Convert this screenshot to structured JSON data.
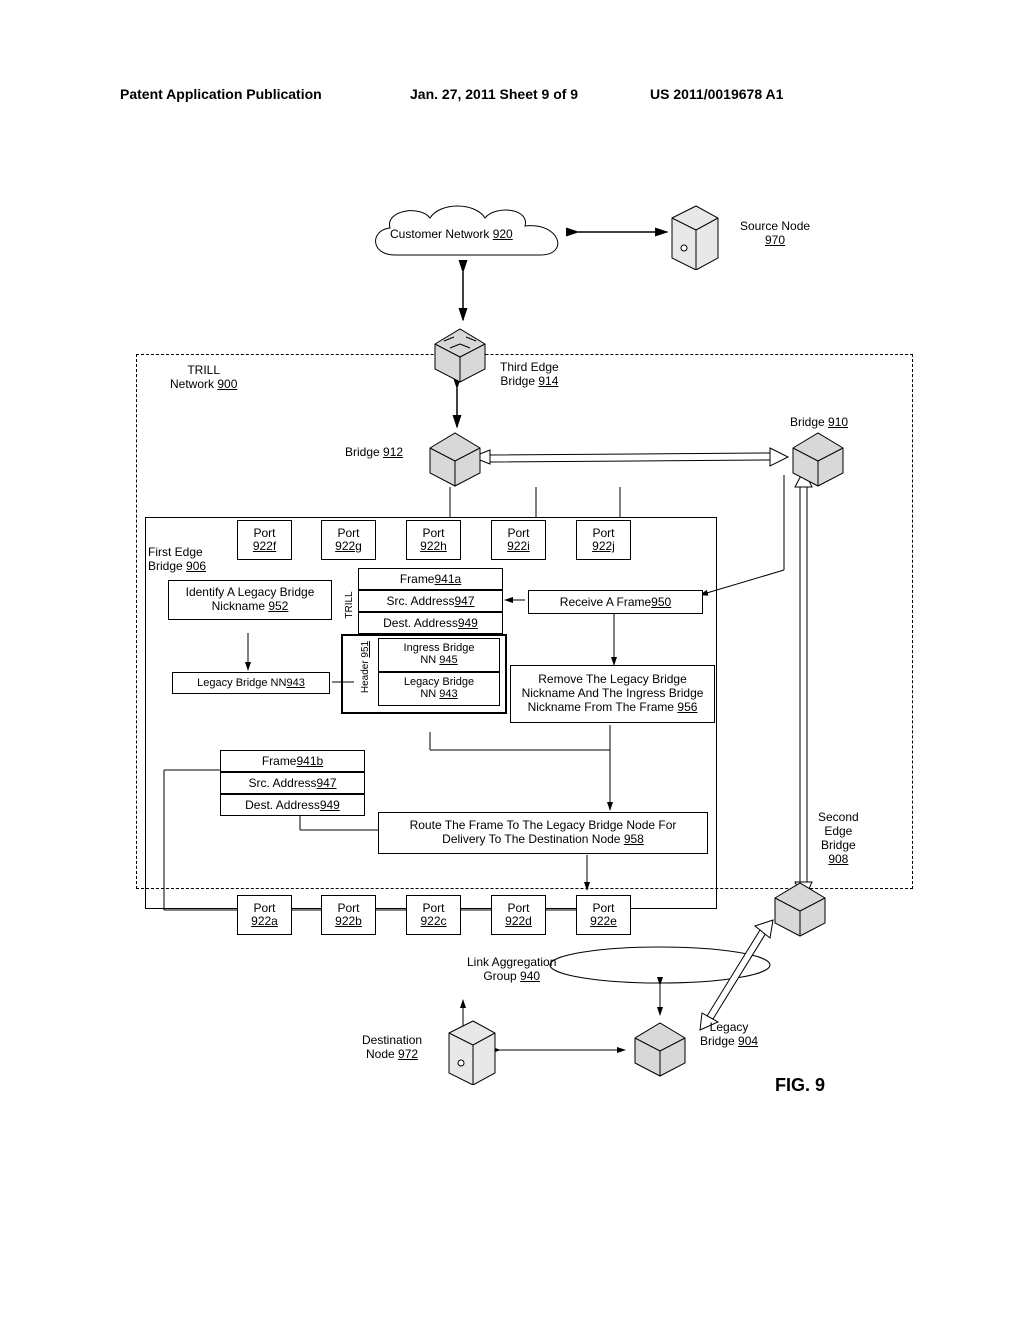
{
  "header": {
    "left": "Patent Application Publication",
    "mid": "Jan. 27, 2011   Sheet 9 of 9",
    "right": "US 2011/0019678 A1"
  },
  "figure_label": "FIG. 9",
  "cloud": {
    "label": "Customer Network ",
    "ref": "920"
  },
  "source_node": {
    "label": "Source Node",
    "ref": "970"
  },
  "trill_label_a": "TRILL",
  "trill_label_b": "Network ",
  "trill_ref": "900",
  "bridges": {
    "third_edge": {
      "label": "Third Edge",
      "sub": "Bridge ",
      "ref": "914"
    },
    "b912": {
      "label": "Bridge ",
      "ref": "912"
    },
    "b910": {
      "label": "Bridge ",
      "ref": "910"
    },
    "first_edge": {
      "label": "First Edge",
      "sub": "Bridge ",
      "ref": "906"
    },
    "second_edge_a": "Second",
    "second_edge_b": "Edge",
    "second_edge_c": "Bridge",
    "second_edge_ref": "908",
    "legacy": {
      "label": "Legacy",
      "sub": "Bridge ",
      "ref": "904"
    }
  },
  "ports_top": [
    {
      "label": "Port",
      "ref": "922f"
    },
    {
      "label": "Port",
      "ref": "922g"
    },
    {
      "label": "Port",
      "ref": "922h"
    },
    {
      "label": "Port",
      "ref": "922i"
    },
    {
      "label": "Port",
      "ref": "922j"
    }
  ],
  "ports_bottom": [
    {
      "label": "Port",
      "ref": "922a"
    },
    {
      "label": "Port",
      "ref": "922b"
    },
    {
      "label": "Port",
      "ref": "922c"
    },
    {
      "label": "Port",
      "ref": "922d"
    },
    {
      "label": "Port",
      "ref": "922e"
    }
  ],
  "identify_box": {
    "l1": "Identify A Legacy Bridge",
    "l2": "Nickname ",
    "ref": "952"
  },
  "legacy_nn_box": {
    "label": "Legacy Bridge NN ",
    "ref": "943"
  },
  "frame_a": {
    "frame": {
      "label": "Frame ",
      "ref": "941a"
    },
    "src": {
      "label": "Src. Address ",
      "ref": "947"
    },
    "dst": {
      "label": "Dest. Address ",
      "ref": "949"
    },
    "ingress": {
      "l1": "Ingress Bridge",
      "l2": "NN ",
      "ref": "945"
    },
    "legacy": {
      "l1": "Legacy Bridge",
      "l2": "NN ",
      "ref": "943"
    },
    "trill_side_a": "TRILL",
    "trill_side_b": "Header ",
    "trill_side_ref": "951"
  },
  "receive_box": {
    "label": "Receive A Frame ",
    "ref": "950"
  },
  "remove_box": {
    "l1": "Remove The Legacy Bridge",
    "l2": "Nickname And The Ingress Bridge",
    "l3": "Nickname From The Frame ",
    "ref": "956"
  },
  "frame_b": {
    "frame": {
      "label": "Frame ",
      "ref": "941b"
    },
    "src": {
      "label": "Src. Address ",
      "ref": "947"
    },
    "dst": {
      "label": "Dest. Address ",
      "ref": "949"
    }
  },
  "route_box": {
    "l1": "Route The Frame To The Legacy Bridge Node For",
    "l2": "Delivery To The Destination Node ",
    "ref": "958"
  },
  "lag": {
    "l1": "Link Aggregation",
    "l2": "Group ",
    "ref": "940"
  },
  "dest_node": {
    "l1": "Destination",
    "l2": "Node ",
    "ref": "972"
  }
}
